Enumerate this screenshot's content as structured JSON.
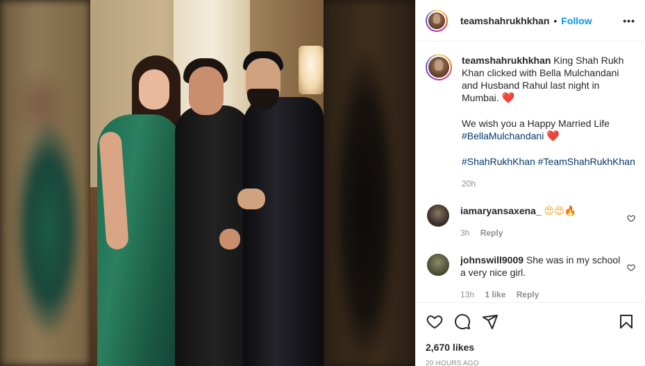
{
  "post": {
    "username": "teamshahrukhkhan",
    "separator": "•",
    "follow_label": "Follow",
    "more_label": "•••"
  },
  "caption": {
    "username": "teamshahrukhkhan",
    "line1": "King Shah Rukh Khan clicked with Bella Mulchandani and Husband Rahul last night in Mumbai.",
    "line2": "We wish you a Happy Married Life",
    "hashtag1": "#BellaMulchandani",
    "hashtag2": "#ShahRukhKhan",
    "hashtag3": "#TeamShahRukhKhan",
    "emoji_heart": "❤️",
    "time": "20h"
  },
  "comments": [
    {
      "username": "iamaryansaxena_",
      "text": "😍😍🔥",
      "time": "3h",
      "reply_label": "Reply"
    },
    {
      "username": "johnswill9009",
      "text": "She was in my school a very nice girl.",
      "time": "13h",
      "likes_label": "1 like",
      "reply_label": "Reply"
    }
  ],
  "actions": {
    "like_icon": "heart-outline-icon",
    "comment_icon": "comment-icon",
    "share_icon": "paper-plane-icon",
    "save_icon": "bookmark-icon"
  },
  "stats": {
    "likes": "2,670 likes",
    "age": "20 HOURS AGO"
  },
  "colors": {
    "follow": "#0095f6",
    "hashtag": "#00376b",
    "muted": "#8e8e8e"
  }
}
